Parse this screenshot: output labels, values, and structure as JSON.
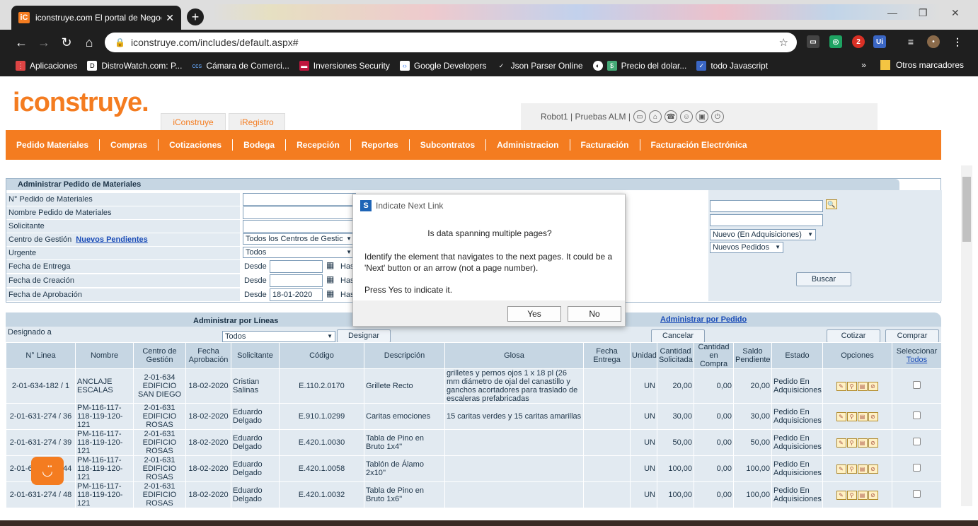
{
  "browser": {
    "tab_title": "iconstruye.com El portal de Negocios",
    "url": "iconstruye.com/includes/default.aspx#",
    "ext_badge": "2",
    "bookmarks": [
      "Aplicaciones",
      "DistroWatch.com: P...",
      "Cámara de Comerci...",
      "Inversiones Security",
      "Google Developers",
      "Json Parser Online",
      "Precio del dolar...",
      "todo Javascript"
    ],
    "bookmarks_more": "»",
    "other_bookmarks": "Otros marcadores"
  },
  "site": {
    "logo": "iconstruye.",
    "top_tabs": [
      "iConstruye",
      "iRegistro"
    ],
    "user": "Robot1 | Pruebas ALM |",
    "menu": [
      "Pedido Materiales",
      "Compras",
      "Cotizaciones",
      "Bodega",
      "Recepción",
      "Reportes",
      "Subcontratos",
      "Administracion",
      "Facturación",
      "Facturación Electrónica"
    ]
  },
  "filters": {
    "title": "Administrar Pedido de Materiales",
    "labels": [
      "N° Pedido de Materiales",
      "Nombre Pedido de Materiales",
      "Solicitante",
      "Centro de Gestión",
      "Urgente",
      "Fecha de Entrega",
      "Fecha de Creación",
      "Fecha de Aprobación"
    ],
    "nuevos_pendientes": "Nuevos Pendientes",
    "centro_gestion_value": "Todos los Centros de Gestic",
    "urgente_value": "Todos",
    "desde": "Desde",
    "hasta": "Has",
    "fecha_aprobacion_desde": "18-01-2020",
    "estado_value": "Nuevo (En Adquisiciones)",
    "tipo_value": "Nuevos Pedidos",
    "buscar": "Buscar"
  },
  "grid": {
    "tab_lineas": "Administrar por Líneas",
    "tab_pedido": "Administrar por Pedido",
    "designado_label": "Designado a",
    "designado_value": "Todos",
    "designar": "Designar",
    "cancelar": "Cancelar",
    "cotizar": "Cotizar",
    "comprar": "Comprar",
    "headers": [
      "N° Linea",
      "Nombre",
      "Centro de Gestión",
      "Fecha Aprobación",
      "Solicitante",
      "Código",
      "Descripción",
      "Glosa",
      "Fecha Entrega",
      "Unidad",
      "Cantidad Solicitada",
      "Cantidad en Compra",
      "Saldo Pendiente",
      "Estado",
      "Opciones",
      "Seleccionar"
    ],
    "select_all": "Todos",
    "rows": [
      {
        "linea": "2-01-634-182 / 1",
        "nombre": "ANCLAJE ESCALAS",
        "centro": "2-01-634 EDIFICIO SAN DIEGO",
        "fecha": "18-02-2020",
        "solicitante": "Cristian Salinas",
        "codigo": "E.110.2.0170",
        "descripcion": "Grillete Recto",
        "glosa": "grilletes y pernos ojos 1 x 18 pl (26 mm diámetro de ojal del canastillo y ganchos acortadores para traslado de escaleras prefabricadas",
        "entrega": "",
        "unidad": "UN",
        "solicitada": "20,00",
        "compra": "0,00",
        "saldo": "20,00",
        "estado": "Pedido En Adquisiciones"
      },
      {
        "linea": "2-01-631-274 / 36",
        "nombre": "PM-116-117-118-119-120-121",
        "centro": "2-01-631 EDIFICIO ROSAS",
        "fecha": "18-02-2020",
        "solicitante": "Eduardo Delgado",
        "codigo": "E.910.1.0299",
        "descripcion": "Caritas emociones",
        "glosa": "15 caritas verdes y 15 caritas amarillas",
        "entrega": "",
        "unidad": "UN",
        "solicitada": "30,00",
        "compra": "0,00",
        "saldo": "30,00",
        "estado": "Pedido En Adquisiciones"
      },
      {
        "linea": "2-01-631-274 / 39",
        "nombre": "PM-116-117-118-119-120-121",
        "centro": "2-01-631 EDIFICIO ROSAS",
        "fecha": "18-02-2020",
        "solicitante": "Eduardo Delgado",
        "codigo": "E.420.1.0030",
        "descripcion": "Tabla de Pino en Bruto 1x4''",
        "glosa": "",
        "entrega": "",
        "unidad": "UN",
        "solicitada": "50,00",
        "compra": "0,00",
        "saldo": "50,00",
        "estado": "Pedido En Adquisiciones"
      },
      {
        "linea": "2-01-631-274 / 44",
        "nombre": "PM-116-117-118-119-120-121",
        "centro": "2-01-631 EDIFICIO ROSAS",
        "fecha": "18-02-2020",
        "solicitante": "Eduardo Delgado",
        "codigo": "E.420.1.0058",
        "descripcion": "Tablón de Álamo 2x10''",
        "glosa": "",
        "entrega": "",
        "unidad": "UN",
        "solicitada": "100,00",
        "compra": "0,00",
        "saldo": "100,00",
        "estado": "Pedido En Adquisiciones"
      },
      {
        "linea": "2-01-631-274 / 48",
        "nombre": "PM-116-117-118-119-120-121",
        "centro": "2-01-631 EDIFICIO ROSAS",
        "fecha": "18-02-2020",
        "solicitante": "Eduardo Delgado",
        "codigo": "E.420.1.0032",
        "descripcion": "Tabla de Pino en Bruto 1x6''",
        "glosa": "",
        "entrega": "",
        "unidad": "UN",
        "solicitada": "100,00",
        "compra": "0,00",
        "saldo": "100,00",
        "estado": "Pedido En Adquisiciones"
      }
    ]
  },
  "dialog": {
    "title": "Indicate Next Link",
    "question": "Is data spanning multiple pages?",
    "text": "Identify the element that navigates to the next pages. It could be a 'Next' button or an arrow (not a page number).",
    "text2": "Press Yes to indicate it.",
    "yes": "Yes",
    "no": "No"
  }
}
